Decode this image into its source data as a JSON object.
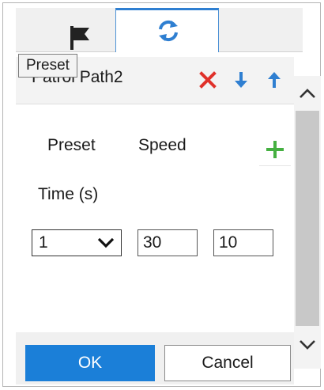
{
  "tabs": [
    {
      "icon": "flag-icon",
      "active": false
    },
    {
      "icon": "refresh-icon",
      "active": true
    }
  ],
  "tooltip": {
    "text": "Preset"
  },
  "header": {
    "path_title": "Patrol Path2",
    "actions": {
      "delete_icon": "close-icon",
      "move_down_icon": "arrow-down-icon",
      "move_up_icon": "arrow-up-icon"
    }
  },
  "table": {
    "columns": [
      "Preset",
      "Speed",
      "Time (s)"
    ],
    "add_icon": "plus-icon",
    "rows": [
      {
        "preset": "1",
        "speed": "30",
        "time": "10"
      }
    ]
  },
  "buttons": {
    "ok": "OK",
    "cancel": "Cancel"
  },
  "colors": {
    "accent": "#1b7fd8",
    "delete": "#e0312a",
    "arrows": "#2f7fd1",
    "add": "#45b041"
  }
}
